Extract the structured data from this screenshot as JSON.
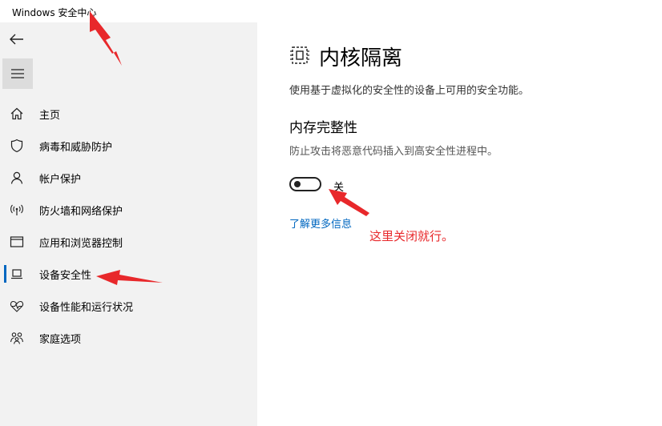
{
  "window": {
    "title": "Windows 安全中心"
  },
  "sidebar": {
    "back_icon": "back-arrow-icon",
    "menu_icon": "hamburger-menu-icon",
    "items": [
      {
        "label": "主页",
        "icon": "home-icon"
      },
      {
        "label": "病毒和威胁防护",
        "icon": "shield-icon"
      },
      {
        "label": "帐户保护",
        "icon": "person-icon"
      },
      {
        "label": "防火墙和网络保护",
        "icon": "wifi-antenna-icon"
      },
      {
        "label": "应用和浏览器控制",
        "icon": "browser-window-icon"
      },
      {
        "label": "设备安全性",
        "icon": "laptop-icon",
        "selected": true
      },
      {
        "label": "设备性能和运行状况",
        "icon": "heart-pulse-icon"
      },
      {
        "label": "家庭选项",
        "icon": "family-icon"
      }
    ]
  },
  "main": {
    "icon": "core-isolation-chip-icon",
    "title": "内核隔离",
    "description": "使用基于虚拟化的安全性的设备上可用的安全功能。",
    "section": {
      "title": "内存完整性",
      "description": "防止攻击将恶意代码插入到高安全性进程中。",
      "toggle": {
        "state_label": "关",
        "on": false
      },
      "learn_more": "了解更多信息"
    }
  },
  "annotation": {
    "text": "这里关闭就行。",
    "color": "#e8282b"
  },
  "colors": {
    "accent": "#0067c0",
    "sidebar_bg": "#f2f2f2",
    "annotation": "#e8282b"
  }
}
